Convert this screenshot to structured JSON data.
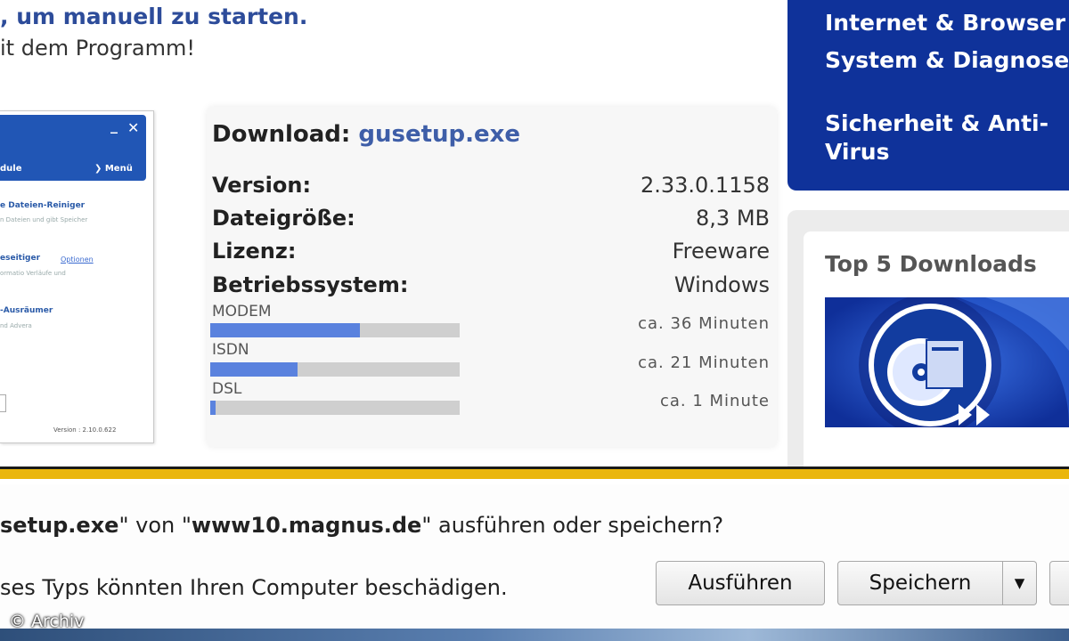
{
  "header": {
    "line1": ", um manuell zu starten.",
    "line2": "it dem Programm!"
  },
  "thumbnail": {
    "minimize": "_",
    "close": "✕",
    "modules_label": "dule",
    "menu_label": "❯ Menü",
    "items": [
      {
        "title": "e Dateien-Reiniger",
        "sub": "n Dateien und gibt Speicher"
      },
      {
        "title": "eseitiger",
        "sub": "ormatio Verläufe und",
        "option": "Optionen"
      },
      {
        "title": "-Ausräumer",
        "sub": "nd Advera"
      }
    ],
    "version": "Version : 2.10.0.622"
  },
  "download": {
    "label": "Download:",
    "filename": "gusetup.exe",
    "rows": [
      {
        "key": "Version:",
        "value": "2.33.0.1158"
      },
      {
        "key": "Dateigröße:",
        "value": "8,3 MB"
      },
      {
        "key": "Lizenz:",
        "value": "Freeware"
      },
      {
        "key": "Betriebssystem:",
        "value": "Windows"
      }
    ],
    "speeds": [
      {
        "label": "MODEM",
        "time": "ca. 36 Minuten",
        "fill": 0.6
      },
      {
        "label": "ISDN",
        "time": "ca. 21 Minuten",
        "fill": 0.35
      },
      {
        "label": "DSL",
        "time": "ca. 1 Minute",
        "fill": 0.02
      }
    ]
  },
  "nav": {
    "items": [
      "Internet & Browser",
      "System & Diagnose",
      "Sicherheit & Anti-",
      "Virus"
    ]
  },
  "top5": {
    "title": "Top 5 Downloads"
  },
  "notification": {
    "question_file": "setup.exe",
    "question_mid": "\" von \"",
    "question_host": "www10.magnus.de",
    "question_end": "\" ausführen oder speichern?",
    "warning": "ses Typs könnten Ihren Computer beschädigen.",
    "run_label": "Ausführen",
    "save_label": "Speichern",
    "dropdown_arrow": "▾"
  },
  "copyright": "© Archiv",
  "colors": {
    "nav_bg": "#0f329a",
    "link": "#3e5ea8",
    "speed_fill": "#5a82de",
    "notify_accent": "#eab60d"
  }
}
